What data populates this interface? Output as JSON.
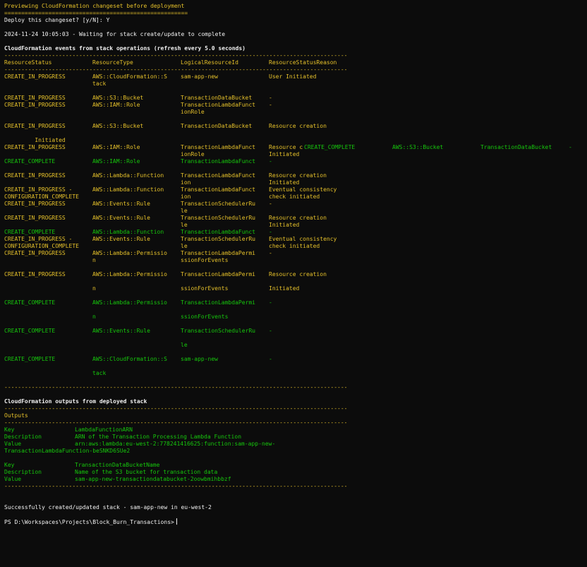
{
  "terminal": {
    "preview_title": "Previewing CloudFormation changeset before deployment",
    "preview_rule": "======================================================",
    "deploy_prompt": "Deploy this changeset? [y/N]: Y",
    "waiting": "2024-11-24 10:05:03 - Waiting for stack create/update to complete",
    "events_title": "CloudFormation events from stack operations (refresh every 5.0 seconds)",
    "events_headers": [
      "ResourceStatus",
      "ResourceType",
      "LogicalResourceId",
      "ResourceStatusReason"
    ],
    "rule": "-------------------------------------------------------------------------------------------------------------------------",
    "events": [
      {
        "status": "CREATE_IN_PROGRESS",
        "type": "AWS::CloudFormation::S",
        "logical": "sam-app-new",
        "reason": "User Initiated",
        "color": "yellow"
      },
      {
        "status": "",
        "type": "tack",
        "logical": "",
        "reason": "",
        "color": "yellow"
      },
      {
        "status": "CREATE_IN_PROGRESS",
        "type": "AWS::S3::Bucket",
        "logical": "TransactionDataBucket",
        "reason": "-",
        "color": "yellow"
      },
      {
        "status": "CREATE_IN_PROGRESS",
        "type": "AWS::IAM::Role",
        "logical": "TransactionLambdaFunct",
        "reason": "-",
        "color": "yellow"
      },
      {
        "status": "",
        "type": "",
        "logical": "ionRole",
        "reason": "",
        "color": "yellow"
      },
      {
        "status": "CREATE_IN_PROGRESS",
        "type": "AWS::S3::Bucket",
        "logical": "TransactionDataBucket",
        "reason": "Resource creation",
        "color": "yellow"
      },
      {
        "status": "         Initiated",
        "type": "",
        "logical": "",
        "reason": "",
        "color": "yellow"
      },
      {
        "status": "CREATE_IN_PROGRESS",
        "type": "AWS::IAM::Role",
        "logical": "TransactionLambdaFunct",
        "reason": "Resource c",
        "color": "yellow"
      },
      {
        "status": "",
        "type": "",
        "logical": "ionRole",
        "reason": "Initiated",
        "color": "yellow"
      },
      {
        "status": "CREATE_COMPLETE",
        "type": "AWS::IAM::Role",
        "logical": "TransactionLambdaFunct",
        "reason": "-",
        "color": "green"
      },
      {
        "status": "CREATE_IN_PROGRESS",
        "type": "AWS::Lambda::Function",
        "logical": "TransactionLambdaFunct",
        "reason": "Resource creation",
        "color": "yellow"
      },
      {
        "status": "",
        "type": "",
        "logical": "ion",
        "reason": "Initiated",
        "color": "yellow"
      },
      {
        "status": "CREATE_IN_PROGRESS -",
        "type": "AWS::Lambda::Function",
        "logical": "TransactionLambdaFunct",
        "reason": "Eventual consistency",
        "color": "yellow"
      },
      {
        "status": "CONFIGURATION_COMPLETE",
        "type": "",
        "logical": "ion",
        "reason": "check initiated",
        "color": "yellow"
      },
      {
        "status": "CREATE_IN_PROGRESS",
        "type": "AWS::Events::Rule",
        "logical": "TransactionSchedulerRu",
        "reason": "-",
        "color": "yellow"
      },
      {
        "status": "",
        "type": "",
        "logical": "le",
        "reason": "",
        "color": "yellow"
      },
      {
        "status": "CREATE_IN_PROGRESS",
        "type": "AWS::Events::Rule",
        "logical": "TransactionSchedulerRu",
        "reason": "Resource creation",
        "color": "yellow"
      },
      {
        "status": "",
        "type": "",
        "logical": "le",
        "reason": "Initiated",
        "color": "yellow"
      },
      {
        "status": "CREATE_COMPLETE",
        "type": "AWS::Lambda::Function",
        "logical": "TransactionLambdaFunct",
        "reason": "-",
        "color": "green"
      },
      {
        "status": "CREATE_IN_PROGRESS -",
        "type": "AWS::Events::Rule",
        "logical": "TransactionSchedulerRu",
        "reason": "Eventual consistency",
        "color": "yellow"
      },
      {
        "status": "CONFIGURATION_COMPLETE",
        "type": "",
        "logical": "le",
        "reason": "check initiated",
        "color": "yellow"
      },
      {
        "status": "CREATE_IN_PROGRESS",
        "type": "AWS::Lambda::Permissio",
        "logical": "TransactionLambdaPermi",
        "reason": "-",
        "color": "yellow"
      },
      {
        "status": "",
        "type": "n",
        "logical": "ssionForEvents",
        "reason": "",
        "color": "yellow"
      },
      {
        "status": "",
        "type": "",
        "logical": "",
        "reason": "",
        "color": "yellow"
      },
      {
        "status": "CREATE_IN_PROGRESS",
        "type": "AWS::Lambda::Permissio",
        "logical": "TransactionLambdaPermi",
        "reason": "Resource creation",
        "color": "yellow"
      },
      {
        "status": "",
        "type": "",
        "logical": "",
        "reason": "",
        "color": "yellow"
      },
      {
        "status": "",
        "type": "n",
        "logical": "ssionForEvents",
        "reason": "Initiated",
        "color": "yellow"
      },
      {
        "status": "",
        "type": "",
        "logical": "",
        "reason": "",
        "color": "yellow"
      },
      {
        "status": "CREATE_COMPLETE",
        "type": "AWS::Lambda::Permissio",
        "logical": "TransactionLambdaPermi",
        "reason": "-",
        "color": "green"
      },
      {
        "status": "",
        "type": "",
        "logical": "",
        "reason": "",
        "color": "green"
      },
      {
        "status": "",
        "type": "n",
        "logical": "ssionForEvents",
        "reason": "",
        "color": "green"
      },
      {
        "status": "",
        "type": "",
        "logical": "",
        "reason": "",
        "color": "green"
      },
      {
        "status": "CREATE_COMPLETE",
        "type": "AWS::Events::Rule",
        "logical": "TransactionSchedulerRu",
        "reason": "-",
        "color": "green"
      },
      {
        "status": "",
        "type": "",
        "logical": "",
        "reason": "",
        "color": "green"
      },
      {
        "status": "",
        "type": "",
        "logical": "le",
        "reason": "",
        "color": "green"
      },
      {
        "status": "",
        "type": "",
        "logical": "",
        "reason": "",
        "color": "green"
      },
      {
        "status": "CREATE_COMPLETE",
        "type": "AWS::CloudFormation::S",
        "logical": "sam-app-new",
        "reason": "-",
        "color": "green"
      },
      {
        "status": "",
        "type": "",
        "logical": "",
        "reason": "",
        "color": "green"
      },
      {
        "status": "",
        "type": "tack",
        "logical": "",
        "reason": "",
        "color": "green"
      }
    ],
    "overlay_line": {
      "status": "CREATE_COMPLETE",
      "type": "AWS::S3::Bucket",
      "logical": "TransactionDataBucket",
      "reason": "-"
    },
    "outputs_title": "CloudFormation outputs from deployed stack",
    "outputs_header": "Outputs",
    "outputs": [
      {
        "key_label": "Key",
        "key": "LambdaFunctionARN",
        "desc_label": "Description",
        "desc": "ARN of the Transaction Processing Lambda Function",
        "value_label": "Value",
        "value": "arn:aws:lambda:eu-west-2:778241416625:function:sam-app-new-",
        "value_cont": "TransactionLambdaFunction-beSNKD6SUe2"
      },
      {
        "key_label": "Key",
        "key": "TransactionDataBucketName",
        "desc_label": "Description",
        "desc": "Name of the S3 bucket for transaction data",
        "value_label": "Value",
        "value": "sam-app-new-transactiondatabucket-2oowbmihbbzf",
        "value_cont": ""
      }
    ],
    "success": "Successfully created/updated stack - sam-app-new in eu-west-2",
    "prompt": "PS D:\\Workspaces\\Projects\\Block_Burn_Transactions>"
  },
  "colors": {
    "background": "#0c0c0c",
    "yellow": "#e5c02a",
    "green": "#16c60c",
    "white": "#f2f2f2"
  }
}
